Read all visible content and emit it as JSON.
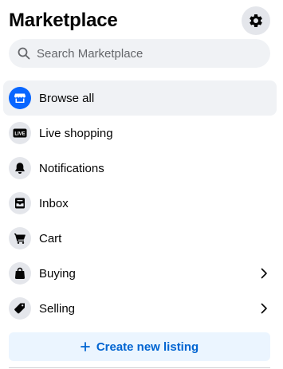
{
  "header": {
    "title": "Marketplace",
    "settings_icon": "gear-icon"
  },
  "search": {
    "placeholder": "Search Marketplace",
    "value": ""
  },
  "nav": {
    "items": [
      {
        "label": "Browse all",
        "icon": "storefront-icon",
        "active": true
      },
      {
        "label": "Live shopping",
        "icon": "live-icon",
        "badge": "LIVE"
      },
      {
        "label": "Notifications",
        "icon": "bell-icon"
      },
      {
        "label": "Inbox",
        "icon": "inbox-icon"
      },
      {
        "label": "Cart",
        "icon": "cart-icon"
      },
      {
        "label": "Buying",
        "icon": "shopping-bag-icon",
        "has_submenu": true
      },
      {
        "label": "Selling",
        "icon": "price-tag-icon",
        "has_submenu": true
      }
    ]
  },
  "create_listing": {
    "label": "Create new listing",
    "icon": "plus-icon"
  },
  "colors": {
    "accent": "#0866ff",
    "button_bg": "#ebf5ff",
    "button_text": "#0064d1",
    "chip_bg": "#e4e6eb"
  }
}
